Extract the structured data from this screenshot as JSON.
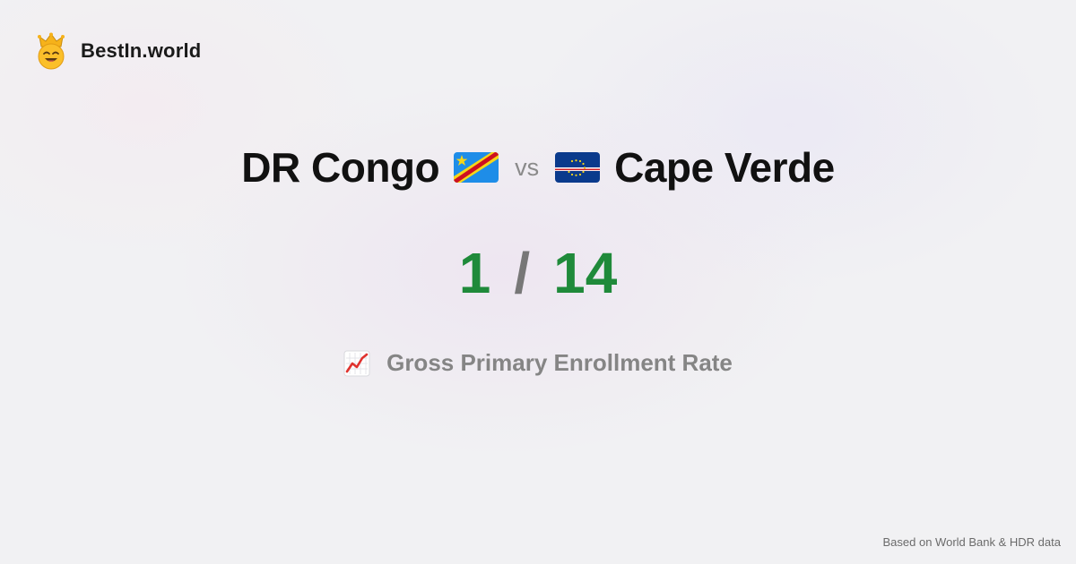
{
  "brand": {
    "name": "BestIn.world",
    "logo_icon": "crown-smiley-icon"
  },
  "comparison": {
    "left": {
      "name": "DR Congo",
      "flag_icon": "flag-dr-congo-icon",
      "rank": "1"
    },
    "separator": "vs",
    "right": {
      "name": "Cape Verde",
      "flag_icon": "flag-cape-verde-icon",
      "rank": "14"
    },
    "rank_separator": "/"
  },
  "metric": {
    "icon": "chart-increasing-icon",
    "label": "Gross Primary Enrollment Rate"
  },
  "footer": {
    "source": "Based on World Bank & HDR data"
  },
  "colors": {
    "rank": "#1f8a3a",
    "background": "#f1f1f3",
    "title": "#111111",
    "muted": "#858585"
  }
}
